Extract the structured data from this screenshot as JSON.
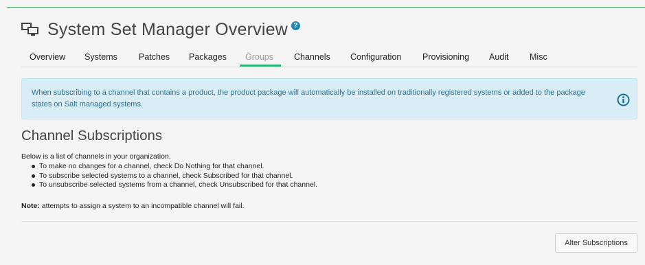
{
  "header": {
    "title": "System Set Manager Overview",
    "help_glyph": "?"
  },
  "tabs": [
    {
      "label": "Overview",
      "active": false
    },
    {
      "label": "Systems",
      "active": false
    },
    {
      "label": "Patches",
      "active": false
    },
    {
      "label": "Packages",
      "active": false
    },
    {
      "label": "Groups",
      "active": true
    },
    {
      "label": "Channels",
      "active": false
    },
    {
      "label": "Configuration",
      "active": false
    },
    {
      "label": "Provisioning",
      "active": false
    },
    {
      "label": "Audit",
      "active": false
    },
    {
      "label": "Misc",
      "active": false
    }
  ],
  "alert": {
    "line1": "When subscribing to a channel that contains a product, the product package will automatically be installed on traditionally registered systems or added to the package",
    "line2": "states on Salt managed systems."
  },
  "section": {
    "title": "Channel Subscriptions",
    "intro": "Below is a list of channels in your organization.",
    "bullets": [
      "To make no changes for a channel, check Do Nothing for that channel.",
      "To subscribe selected systems to a channel, check Subscribed for that channel.",
      "To unsubscribe selected systems from a channel, check Unsubscribed for that channel."
    ],
    "note_label": "Note:",
    "note_text": " attempts to assign a system to an incompatible channel will fail."
  },
  "actions": {
    "alter_label": "Alter Subscriptions"
  },
  "colors": {
    "accent_green": "#2bb673",
    "info_blue": "#1f8ab5",
    "alert_bg": "#d9edf7",
    "alert_text": "#31708f"
  }
}
